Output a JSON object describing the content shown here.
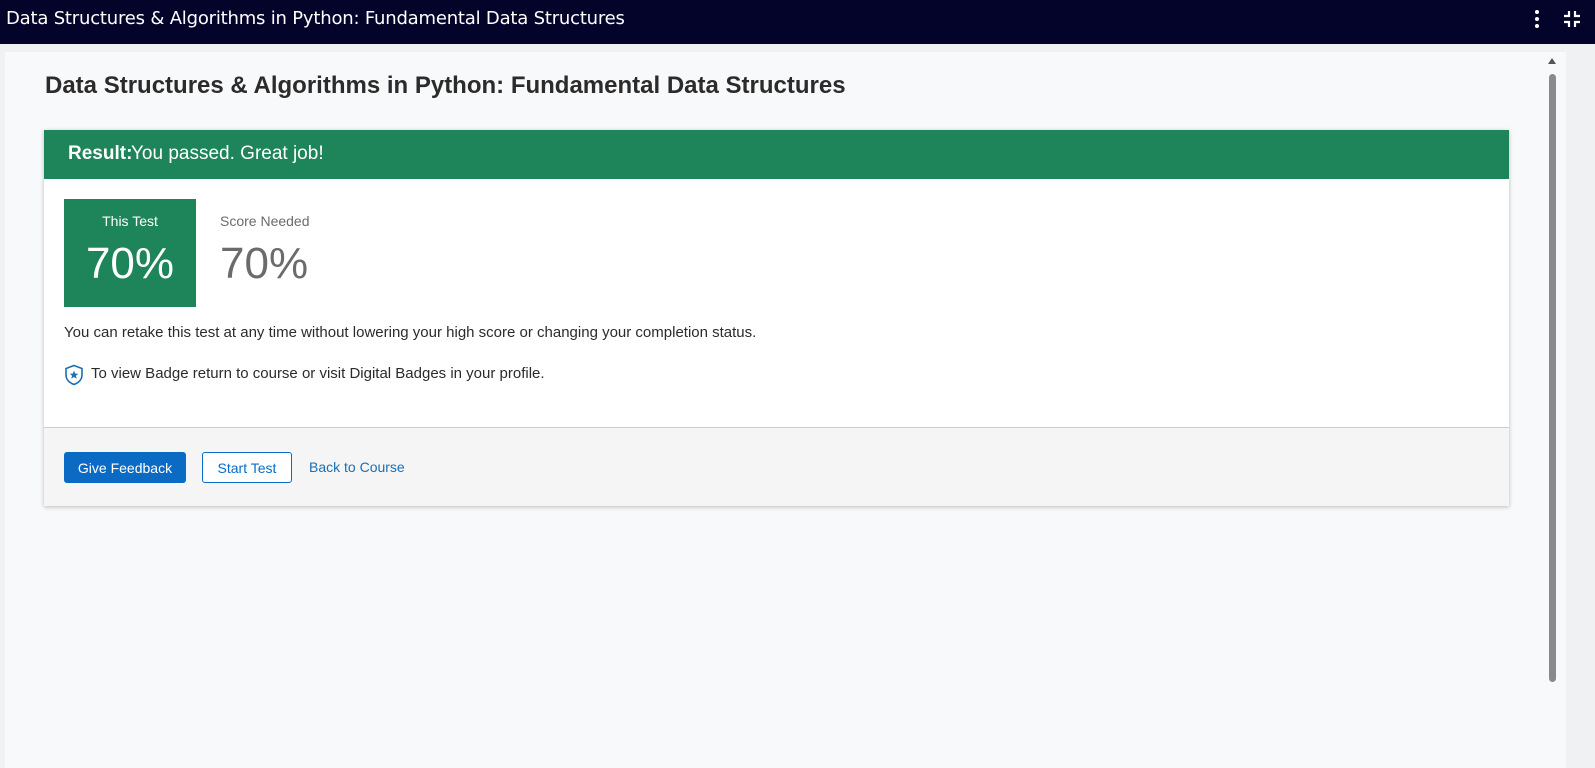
{
  "topbar": {
    "title": "Data Structures & Algorithms in Python: Fundamental Data Structures",
    "menu_icon": "kebab-menu-icon",
    "collapse_icon": "exit-fullscreen-icon"
  },
  "page": {
    "title": "Data Structures & Algorithms in Python: Fundamental Data Structures"
  },
  "result": {
    "label": "Result:",
    "text": "You passed. Great job!",
    "color": "#1e8459"
  },
  "scores": {
    "this_test_label": "This Test",
    "this_test_value": "70%",
    "needed_label": "Score Needed",
    "needed_value": "70%"
  },
  "messages": {
    "retake": "You can retake this test at any time without lowering your high score or changing your completion status.",
    "badge": "To view Badge return to course or visit Digital Badges in your profile.",
    "badge_icon": "badge-shield-icon"
  },
  "actions": {
    "give_feedback": "Give Feedback",
    "start_test": "Start Test",
    "back_to_course": "Back to Course",
    "accent_color": "#0b6bc4"
  }
}
